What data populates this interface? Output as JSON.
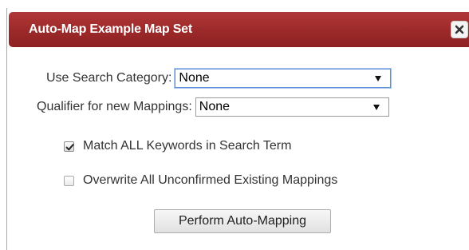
{
  "dialog": {
    "title": "Auto-Map Example Map Set",
    "close_icon": "close-icon",
    "accent_color": "#9d2a2a"
  },
  "form": {
    "search_category": {
      "label": "Use Search Category:",
      "selected": "None"
    },
    "qualifier": {
      "label": "Qualifier for new Mappings:",
      "selected": "None"
    },
    "match_all_keywords": {
      "label": "Match ALL Keywords in Search Term",
      "checked": true
    },
    "overwrite_unconfirmed": {
      "label": "Overwrite All Unconfirmed Existing Mappings",
      "checked": false
    },
    "submit_label": "Perform Auto-Mapping"
  }
}
